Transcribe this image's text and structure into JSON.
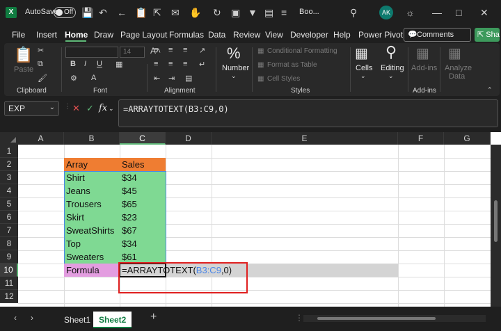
{
  "titlebar": {
    "autosave_label": "AutoSave",
    "autosave_state": "Off",
    "doc_title": "Boo...",
    "avatar_initials": "AK"
  },
  "menu": {
    "items": [
      "File",
      "Insert",
      "Home",
      "Draw",
      "Page Layout",
      "Formulas",
      "Data",
      "Review",
      "View",
      "Developer",
      "Help",
      "Power Pivot"
    ],
    "active": "Home",
    "comments_label": "Comments",
    "share_label": "Share"
  },
  "ribbon": {
    "clipboard": {
      "paste_label": "Paste",
      "group_label": "Clipboard"
    },
    "font": {
      "size_value": "14",
      "group_label": "Font"
    },
    "alignment": {
      "group_label": "Alignment"
    },
    "number": {
      "label": "Number",
      "icon_glyph": "%"
    },
    "styles": {
      "conditional_formatting": "Conditional Formatting",
      "format_as_table": "Format as Table",
      "cell_styles": "Cell Styles",
      "group_label": "Styles"
    },
    "cells": {
      "label": "Cells"
    },
    "editing": {
      "label": "Editing"
    },
    "addins": {
      "label": "Add-ins",
      "group_label": "Add-ins"
    },
    "analyze": {
      "label_line1": "Analyze",
      "label_line2": "Data"
    }
  },
  "formula_bar": {
    "name_box": "EXP",
    "fx_label": "fx",
    "formula": "=ARRAYTOTEXT(B3:C9,0)"
  },
  "grid": {
    "columns": [
      "A",
      "B",
      "C",
      "D",
      "E",
      "F",
      "G"
    ],
    "rows": [
      "1",
      "2",
      "3",
      "4",
      "5",
      "6",
      "7",
      "8",
      "9",
      "10",
      "11",
      "12"
    ],
    "header": {
      "array": "Array",
      "sales": "Sales"
    },
    "data": [
      {
        "item": "Shirt",
        "sales": "$34"
      },
      {
        "item": "Jeans",
        "sales": "$45"
      },
      {
        "item": "Trousers",
        "sales": "$65"
      },
      {
        "item": "Skirt",
        "sales": "$23"
      },
      {
        "item": "SweatShirts",
        "sales": "$67"
      },
      {
        "item": "Top",
        "sales": "$34"
      },
      {
        "item": "Sweaters",
        "sales": "$61"
      }
    ],
    "formula_label": "Formula",
    "edit_prefix": "=ARRAYTOTEXT(",
    "edit_ref": "B3:C9",
    "edit_suffix": ",0)"
  },
  "tabs": {
    "sheets": [
      "Sheet1",
      "Sheet2"
    ],
    "active": "Sheet2",
    "add_label": "+"
  },
  "colors": {
    "header_orange": "#ef7d32",
    "data_green": "#7fd993",
    "formula_pink": "#e39de0",
    "ref_blue": "#4a86e8",
    "highlight_red": "#e02020"
  }
}
